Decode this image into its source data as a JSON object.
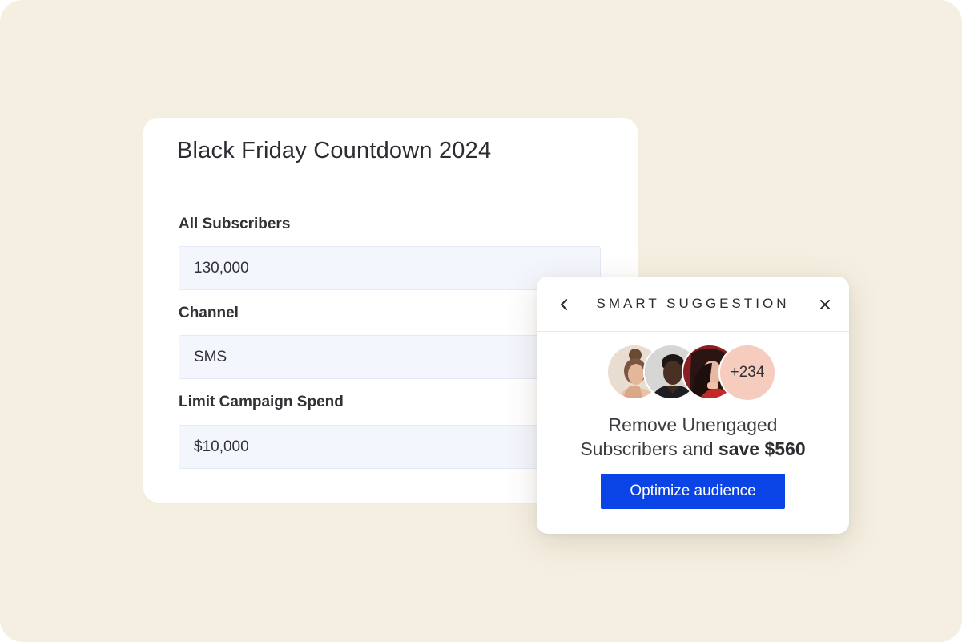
{
  "campaign": {
    "title": "Black Friday Countdown 2024",
    "fields": [
      {
        "label": "All Subscribers",
        "value": "130,000"
      },
      {
        "label": "Channel",
        "value": "SMS"
      },
      {
        "label": "Limit Campaign Spend",
        "value": "$10,000"
      }
    ]
  },
  "suggestion": {
    "title": "SMART SUGGESTION",
    "back_icon": "chevron-left-icon",
    "close_icon": "close-icon",
    "avatar_overflow": "+234",
    "message_line1": "Remove Unengaged",
    "message_line2_prefix": "Subscribers and ",
    "message_highlight": "save $560",
    "button_label": "Optimize audience"
  },
  "colors": {
    "background": "#f5efe2",
    "primary_button": "#0a44e6",
    "input_bg": "#f3f6fd",
    "avatar_count_bg": "#f6ccbf"
  }
}
